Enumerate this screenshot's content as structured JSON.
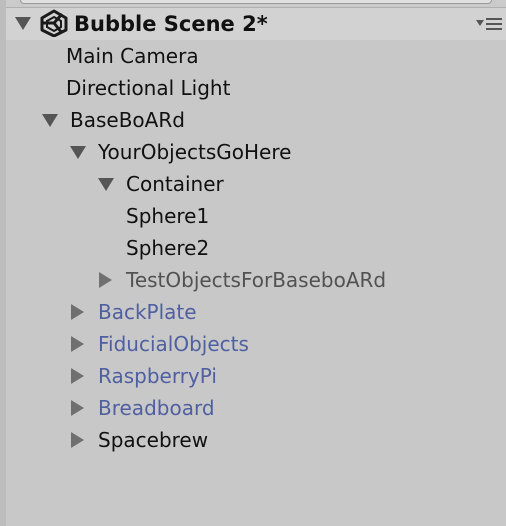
{
  "scene": {
    "title": "Bubble Scene 2*",
    "expanded": true,
    "icon": "unity-logo-icon",
    "menu_icon": "context-menu-icon"
  },
  "hierarchy": [
    {
      "label": "Main Camera",
      "depth": 0,
      "state": "leaf",
      "style": "normal"
    },
    {
      "label": "Directional Light",
      "depth": 0,
      "state": "leaf",
      "style": "normal"
    },
    {
      "label": "BaseBoARd",
      "depth": 0,
      "state": "expanded",
      "style": "normal"
    },
    {
      "label": "YourObjectsGoHere",
      "depth": 1,
      "state": "expanded",
      "style": "normal"
    },
    {
      "label": "Container",
      "depth": 2,
      "state": "expanded",
      "style": "normal"
    },
    {
      "label": "Sphere1",
      "depth": 3,
      "state": "leaf",
      "style": "normal"
    },
    {
      "label": "Sphere2",
      "depth": 3,
      "state": "leaf",
      "style": "normal"
    },
    {
      "label": "TestObjectsForBaseboARd",
      "depth": 2,
      "state": "collapsed",
      "style": "inactive"
    },
    {
      "label": "BackPlate",
      "depth": 1,
      "state": "collapsed",
      "style": "prefab"
    },
    {
      "label": "FiducialObjects",
      "depth": 1,
      "state": "collapsed",
      "style": "prefab"
    },
    {
      "label": "RaspberryPi",
      "depth": 1,
      "state": "collapsed",
      "style": "prefab"
    },
    {
      "label": "Breadboard",
      "depth": 1,
      "state": "collapsed",
      "style": "prefab"
    },
    {
      "label": "Spacebrew",
      "depth": 1,
      "state": "collapsed",
      "style": "normal"
    }
  ],
  "colors": {
    "background": "#c8c8c8",
    "header": "#d2d2d2",
    "text": "#111111",
    "prefab_text": "#4f5fa0",
    "inactive_text": "#525252",
    "arrow": "#555555"
  }
}
